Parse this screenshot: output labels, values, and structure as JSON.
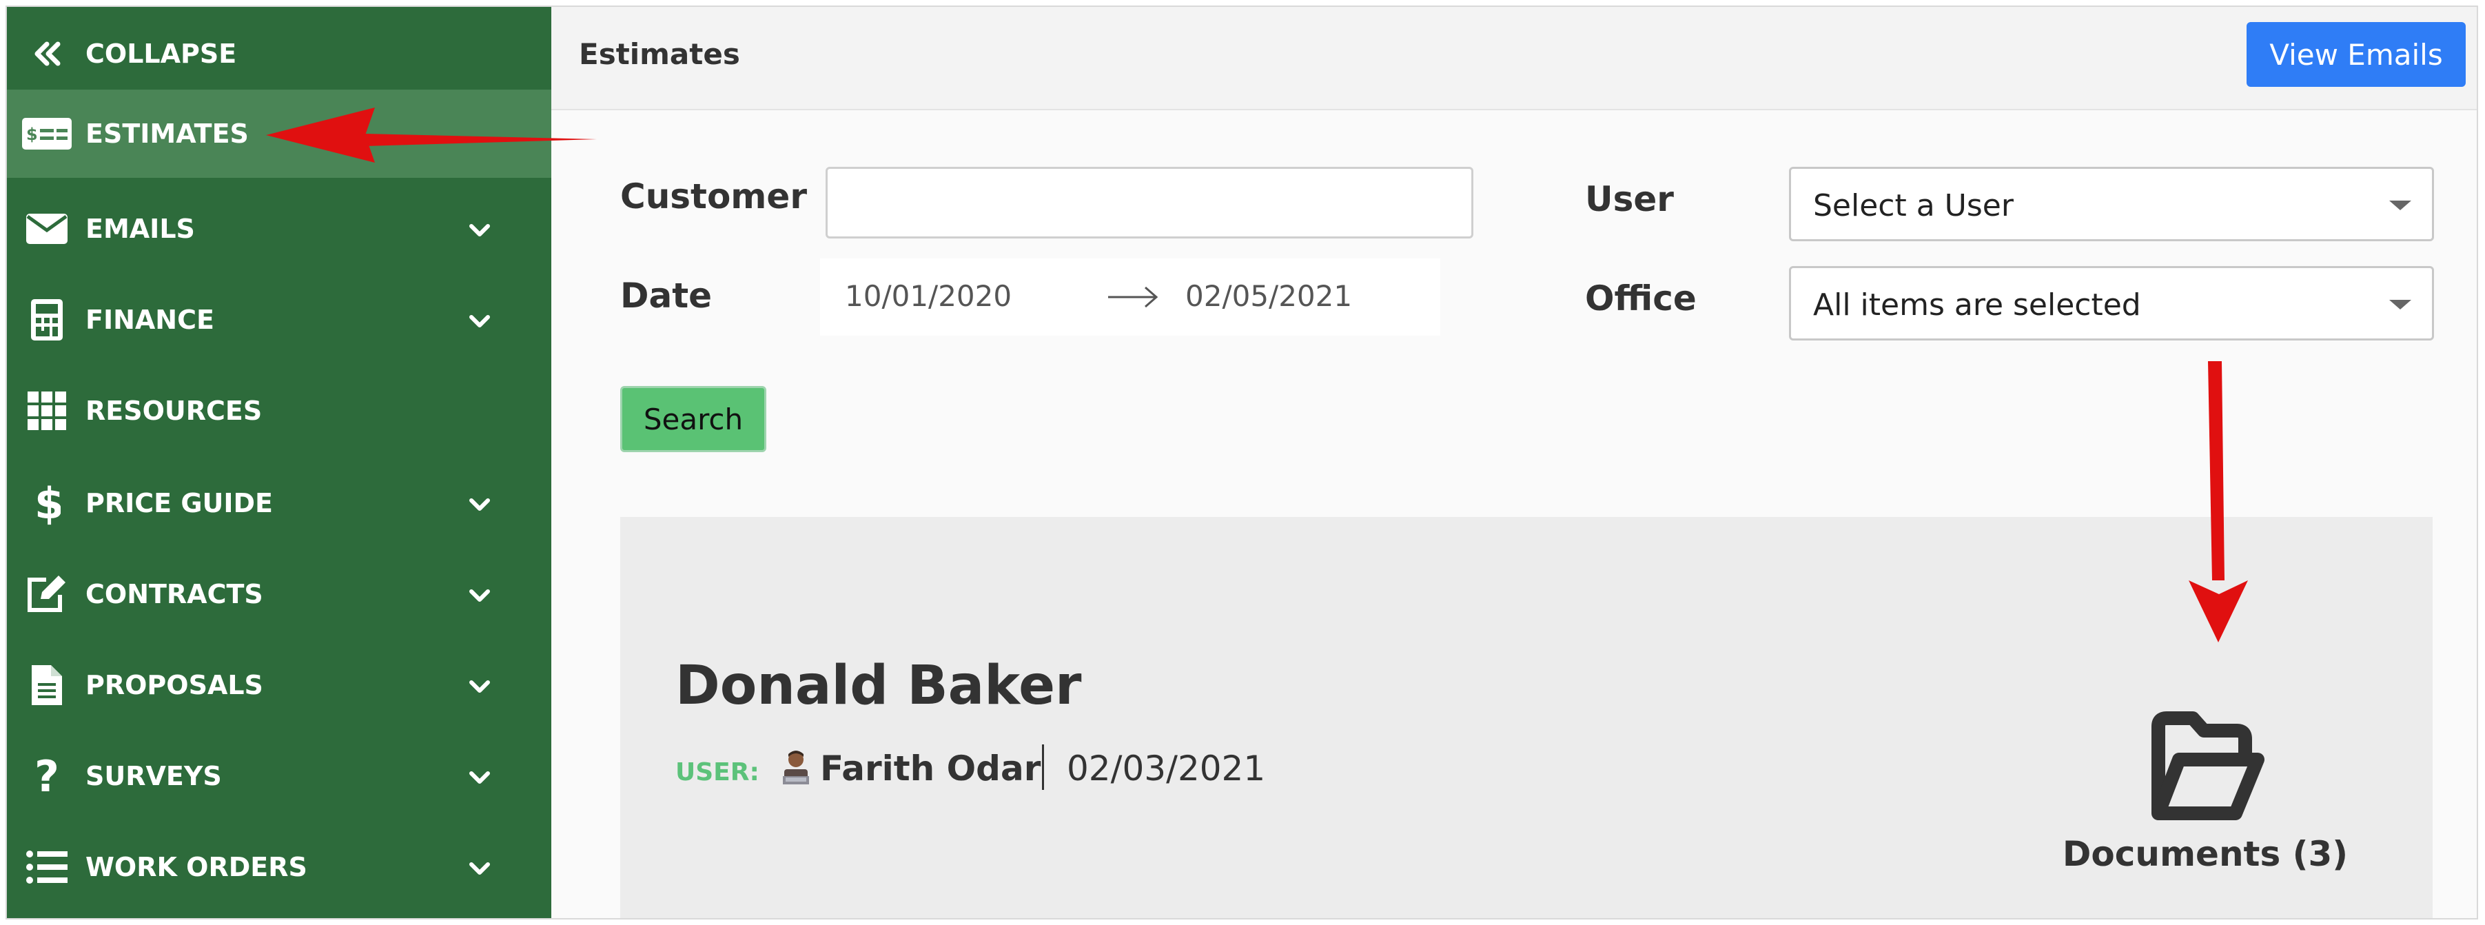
{
  "sidebar": {
    "items": [
      {
        "label": "COLLAPSE",
        "icon": "double-chevron-left-icon"
      },
      {
        "label": "ESTIMATES",
        "icon": "estimate-bill-icon"
      },
      {
        "label": "EMAILS",
        "icon": "envelope-icon"
      },
      {
        "label": "FINANCE",
        "icon": "calculator-icon"
      },
      {
        "label": "RESOURCES",
        "icon": "grid-icon"
      },
      {
        "label": "PRICE GUIDE",
        "icon": "dollar-icon"
      },
      {
        "label": "CONTRACTS",
        "icon": "edit-icon"
      },
      {
        "label": "PROPOSALS",
        "icon": "document-icon"
      },
      {
        "label": "SURVEYS",
        "icon": "question-icon"
      },
      {
        "label": "WORK ORDERS",
        "icon": "list-icon"
      }
    ],
    "active": "ESTIMATES",
    "bg_color": "#2d6b3b",
    "active_color": "#4a8556"
  },
  "header": {
    "title": "Estimates",
    "view_emails_label": "View Emails",
    "accent_color": "#2f7df6"
  },
  "filters": {
    "customer_label": "Customer",
    "customer_value": "",
    "date_label": "Date",
    "date_from": "10/01/2020",
    "date_to": "02/05/2021",
    "user_label": "User",
    "user_value": "Select a User",
    "office_label": "Office",
    "office_value": "All items are selected",
    "search_label": "Search"
  },
  "estimate_card": {
    "customer_name": "Donald Baker",
    "user_label": "USER:",
    "user_name": "Farith Odar",
    "date": "02/03/2021",
    "documents_label": "Documents (3)"
  },
  "annotation_color": "#e01010"
}
